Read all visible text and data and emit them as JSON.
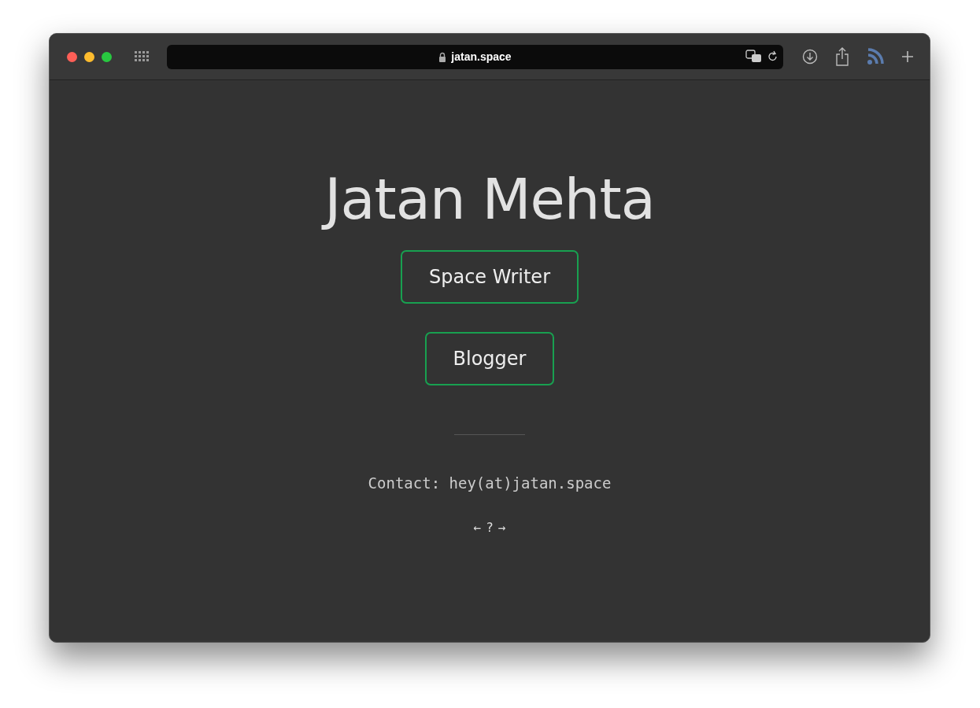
{
  "browser": {
    "url": "jatan.space"
  },
  "page": {
    "title": "Jatan Mehta",
    "links": [
      {
        "label": "Space Writer"
      },
      {
        "label": "Blogger"
      }
    ],
    "contact": "Contact: hey(at)jatan.space",
    "webring": [
      {
        "label": "←"
      },
      {
        "label": "?"
      },
      {
        "label": "→"
      }
    ]
  }
}
